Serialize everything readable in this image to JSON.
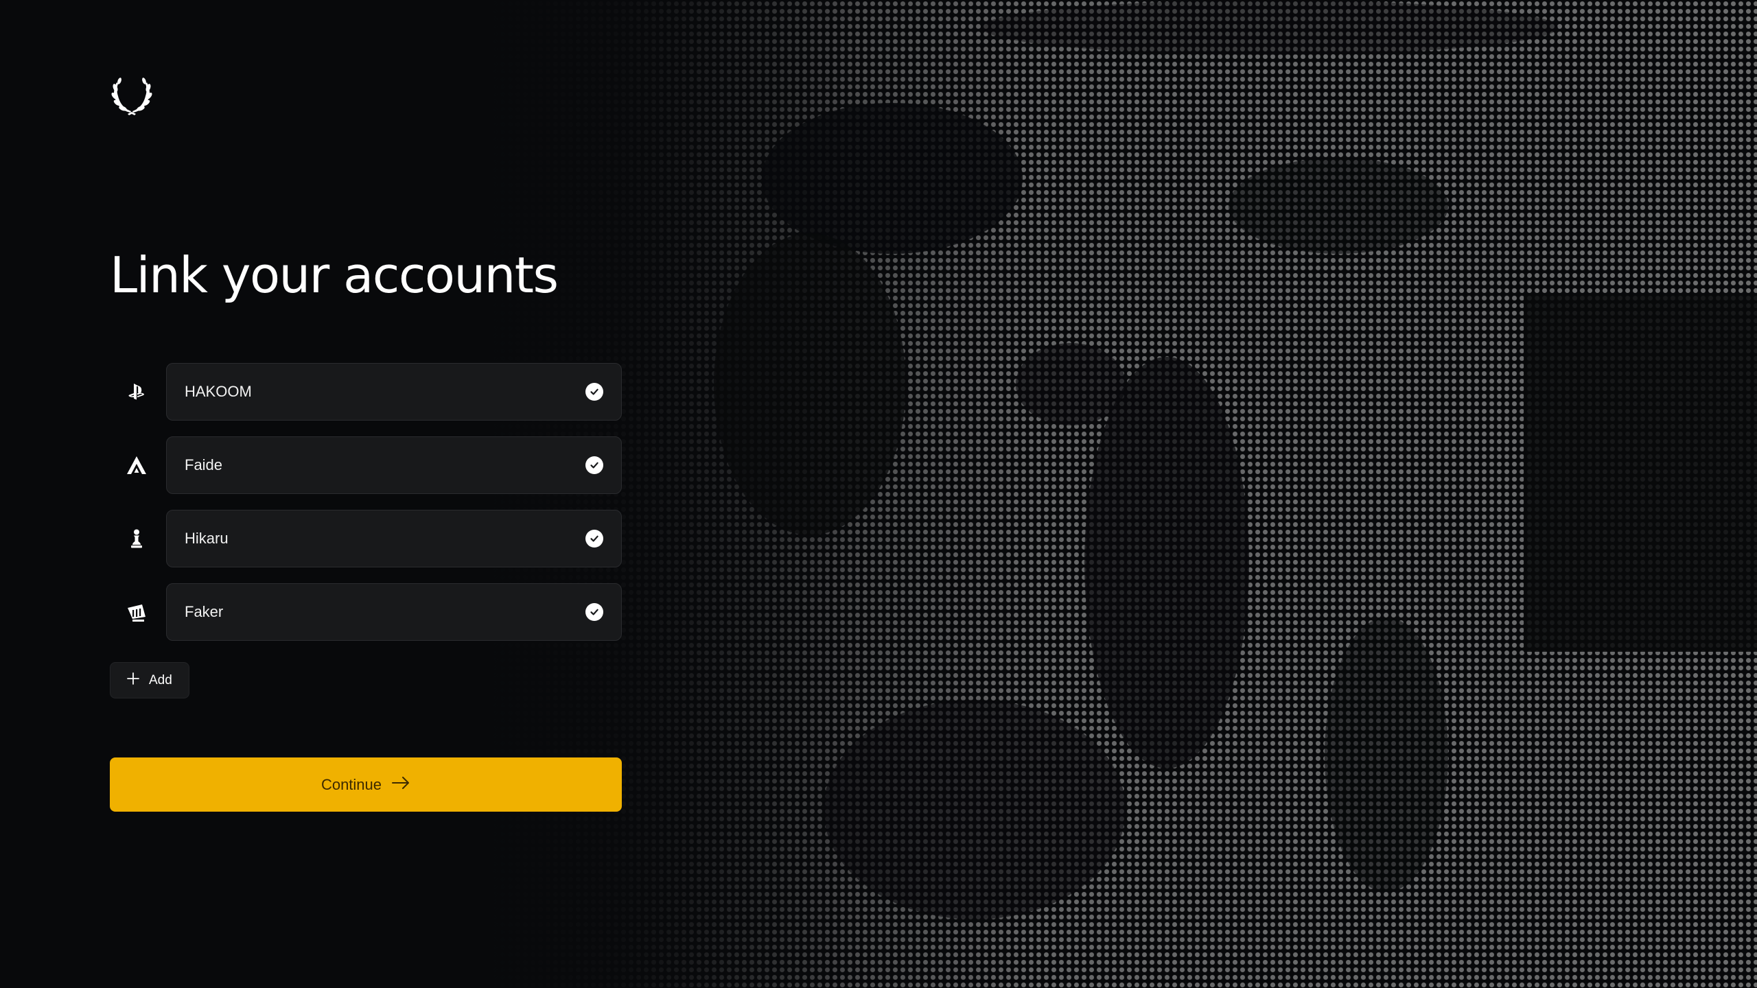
{
  "page": {
    "title": "Link your accounts"
  },
  "accounts": [
    {
      "platform_icon": "playstation-icon",
      "name": "HAKOOM",
      "linked": true
    },
    {
      "platform_icon": "apex-legends-icon",
      "name": "Faide",
      "linked": true
    },
    {
      "platform_icon": "chess-pawn-icon",
      "name": "Hikaru",
      "linked": true
    },
    {
      "platform_icon": "riot-games-icon",
      "name": "Faker",
      "linked": true
    }
  ],
  "actions": {
    "add_label": "Add",
    "continue_label": "Continue"
  },
  "colors": {
    "background": "#08090b",
    "field_background": "#18191b",
    "accent": "#f0b100",
    "accent_text": "#3d2a00"
  },
  "icons": {
    "logo": "laurel-wreath-icon",
    "linked_status": "check-circle-icon",
    "add": "plus-icon",
    "continue": "arrow-right-icon"
  }
}
